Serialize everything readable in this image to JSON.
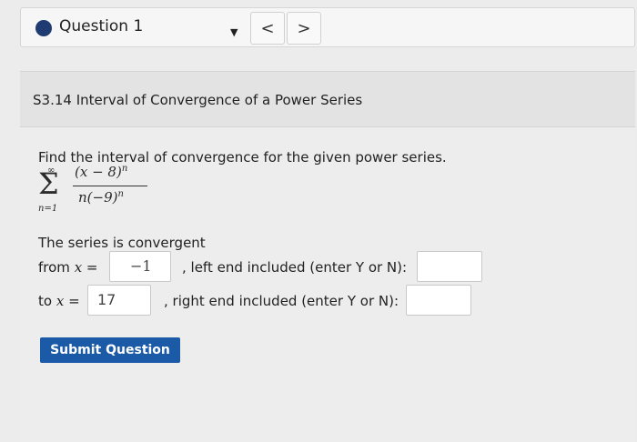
{
  "question_nav": {
    "question_label": "Question 1",
    "prev_glyph": "<",
    "next_glyph": ">",
    "dropdown_glyph": "▼"
  },
  "section": {
    "title": "S3.14 Interval of Convergence of a Power Series"
  },
  "problem": {
    "prompt": "Find the interval of convergence for the given power series.",
    "sum_upper": "∞",
    "sum_lower": "n=1",
    "numerator": "(x − 8)",
    "numerator_exp": "n",
    "denominator": "n(−9)",
    "denominator_exp": "n",
    "status": "The series is convergent"
  },
  "form": {
    "from_label_pre": "from ",
    "from_var": "x",
    "from_label_post": " =",
    "from_value": "−1",
    "left_end_label": ", left end included (enter Y or N):",
    "left_end_value": "",
    "to_label_pre": "to ",
    "to_var": "x",
    "to_label_post": " =",
    "to_value": "17",
    "right_end_label": ", right end included (enter Y or N):",
    "right_end_value": ""
  },
  "actions": {
    "submit_label": "Submit Question"
  },
  "colors": {
    "accent": "#1a5aa6",
    "question_dot": "#1f3c72"
  }
}
